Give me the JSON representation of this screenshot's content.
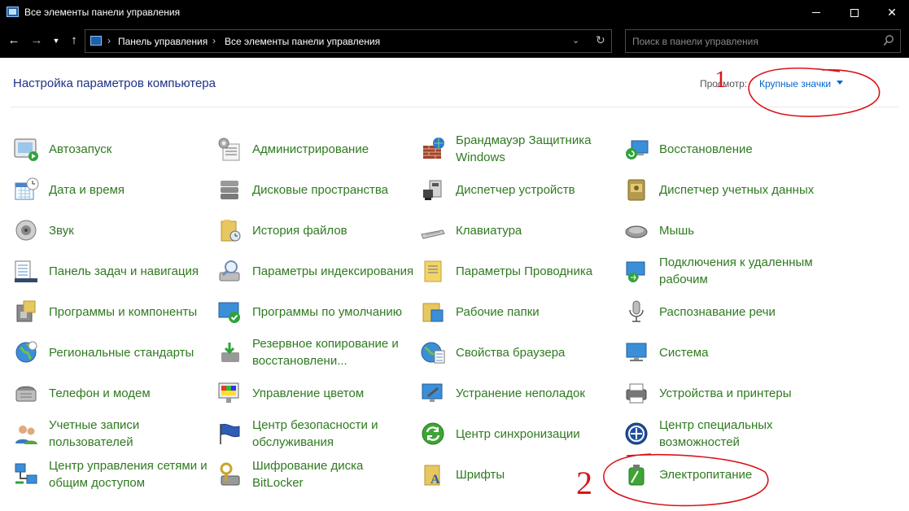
{
  "window": {
    "title": "Все элементы панели управления"
  },
  "address": {
    "crumbs": [
      "Панель управления",
      "Все элементы панели управления"
    ],
    "search_placeholder": "Поиск в панели управления"
  },
  "header": {
    "title": "Настройка параметров компьютера",
    "view_by_label": "Просмотр:",
    "view_by_value": "Крупные значки"
  },
  "annotations": [
    "1",
    "2"
  ],
  "items": [
    {
      "label": "Автозапуск",
      "icon": "autoplay-icon"
    },
    {
      "label": "Администрирование",
      "icon": "admin-tools-icon"
    },
    {
      "label": "Брандмауэр Защитника Windows",
      "icon": "firewall-icon"
    },
    {
      "label": "Восстановление",
      "icon": "recovery-icon"
    },
    {
      "label": "Дата и время",
      "icon": "date-time-icon"
    },
    {
      "label": "Дисковые пространства",
      "icon": "storage-spaces-icon"
    },
    {
      "label": "Диспетчер устройств",
      "icon": "device-manager-icon"
    },
    {
      "label": "Диспетчер учетных данных",
      "icon": "credential-manager-icon"
    },
    {
      "label": "Звук",
      "icon": "sound-icon"
    },
    {
      "label": "История файлов",
      "icon": "file-history-icon"
    },
    {
      "label": "Клавиатура",
      "icon": "keyboard-icon"
    },
    {
      "label": "Мышь",
      "icon": "mouse-icon"
    },
    {
      "label": "Панель задач и навигация",
      "icon": "taskbar-icon"
    },
    {
      "label": "Параметры индексирования",
      "icon": "indexing-icon"
    },
    {
      "label": "Параметры Проводника",
      "icon": "explorer-options-icon"
    },
    {
      "label": "Подключения к удаленным рабочим",
      "icon": "remote-desktop-icon"
    },
    {
      "label": "Программы и компоненты",
      "icon": "programs-icon"
    },
    {
      "label": "Программы по умолчанию",
      "icon": "default-programs-icon"
    },
    {
      "label": "Рабочие папки",
      "icon": "work-folders-icon"
    },
    {
      "label": "Распознавание речи",
      "icon": "speech-icon"
    },
    {
      "label": "Региональные стандарты",
      "icon": "region-icon"
    },
    {
      "label": "Резервное копирование и восстановлени...",
      "icon": "backup-icon"
    },
    {
      "label": "Свойства браузера",
      "icon": "internet-options-icon"
    },
    {
      "label": "Система",
      "icon": "system-icon"
    },
    {
      "label": "Телефон и модем",
      "icon": "phone-modem-icon"
    },
    {
      "label": "Управление цветом",
      "icon": "color-management-icon"
    },
    {
      "label": "Устранение неполадок",
      "icon": "troubleshooting-icon"
    },
    {
      "label": "Устройства и принтеры",
      "icon": "devices-printers-icon"
    },
    {
      "label": "Учетные записи пользователей",
      "icon": "user-accounts-icon"
    },
    {
      "label": "Центр безопасности и обслуживания",
      "icon": "security-maintenance-icon"
    },
    {
      "label": "Центр синхронизации",
      "icon": "sync-center-icon"
    },
    {
      "label": "Центр специальных возможностей",
      "icon": "ease-of-access-icon"
    },
    {
      "label": "Центр управления сетями и общим доступом",
      "icon": "network-center-icon"
    },
    {
      "label": "Шифрование диска BitLocker",
      "icon": "bitlocker-icon"
    },
    {
      "label": "Шрифты",
      "icon": "fonts-icon"
    },
    {
      "label": "Электропитание",
      "icon": "power-options-icon"
    }
  ]
}
